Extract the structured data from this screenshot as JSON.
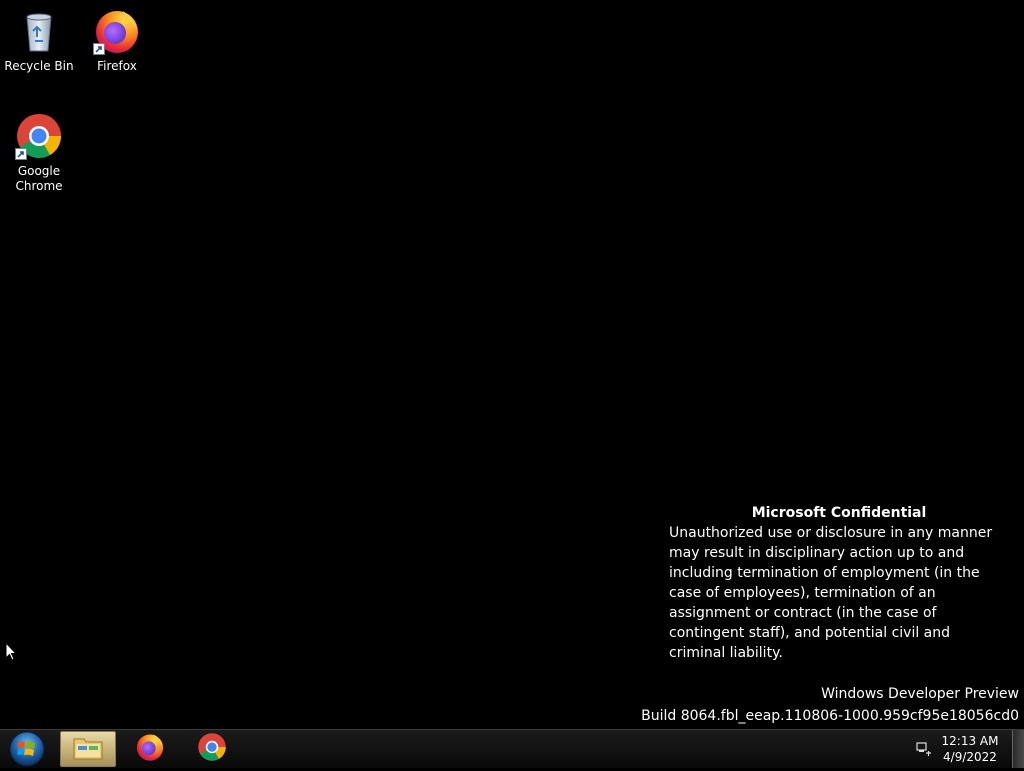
{
  "desktop": {
    "icons": [
      {
        "label": "Recycle Bin",
        "icon": "recycle-bin-icon"
      },
      {
        "label": "Firefox",
        "icon": "firefox-icon"
      },
      {
        "label": "Google\nChrome",
        "icon": "chrome-icon"
      }
    ]
  },
  "watermark": {
    "title": "Microsoft Confidential",
    "body": "Unauthorized use or disclosure in any manner may result in disciplinary action up to and including termination of employment (in the case of employees), termination of an assignment or contract (in the case of contingent staff), and potential civil and criminal liability.",
    "product": "Windows Developer Preview",
    "build": "Build 8064.fbl_eeap.110806-1000.959cf95e18056cd0"
  },
  "taskbar": {
    "items": [
      {
        "icon": "file-explorer-icon",
        "active": true
      },
      {
        "icon": "firefox-icon",
        "active": false
      },
      {
        "icon": "chrome-icon",
        "active": false
      }
    ],
    "clock": {
      "time": "12:13 AM",
      "date": "4/9/2022"
    }
  },
  "colors": {
    "desktop_bg": "#000000",
    "taskbar_bg": "#121212",
    "text": "#ffffff"
  }
}
